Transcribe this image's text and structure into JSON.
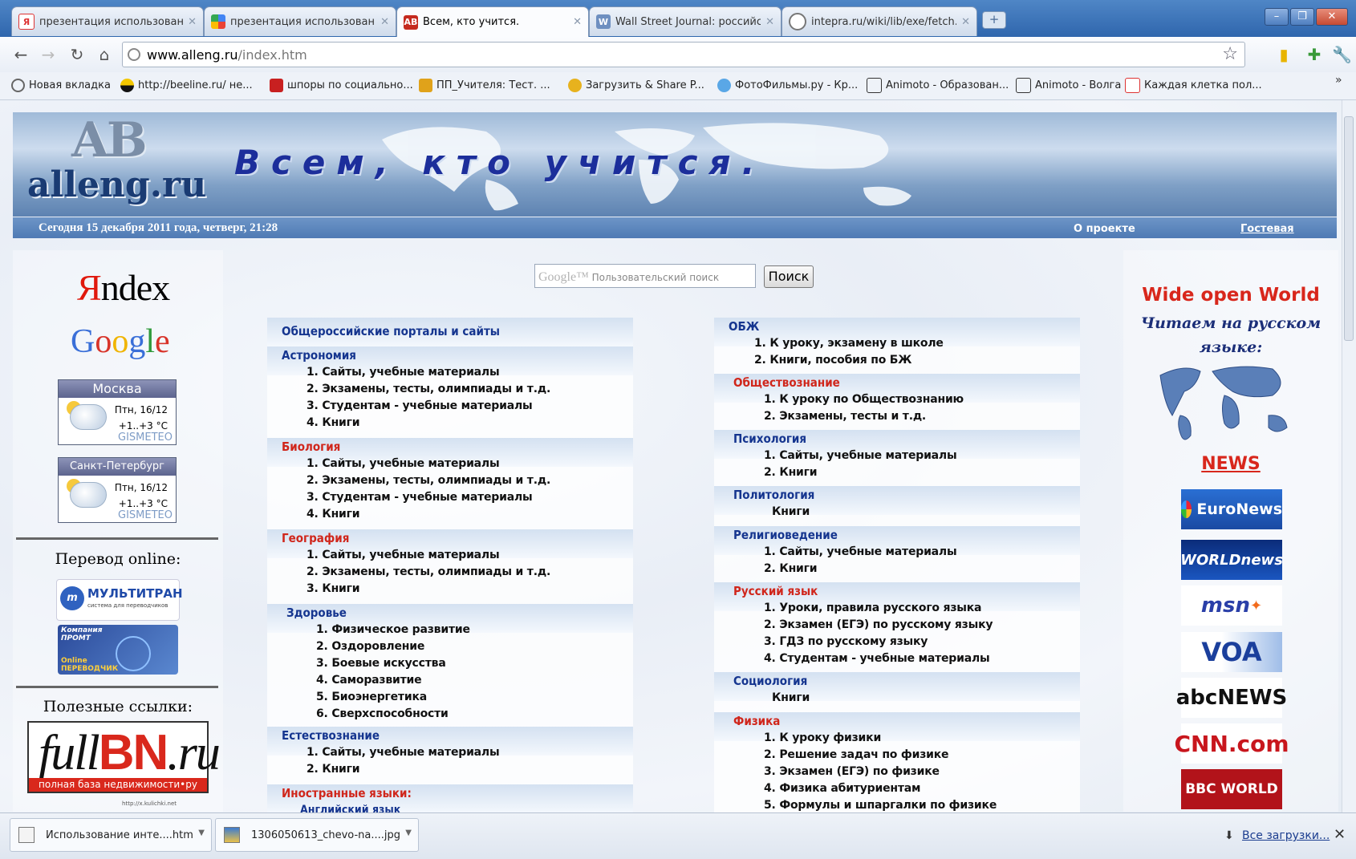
{
  "browser": {
    "tabs": [
      {
        "title": "презентация использование",
        "active": false,
        "icon": "yandex-icon"
      },
      {
        "title": "презентация использование",
        "active": false,
        "icon": "google-icon"
      },
      {
        "title": "Всем, кто учится.",
        "active": true,
        "icon": "alleng-icon"
      },
      {
        "title": "Wall Street Journal: российск",
        "active": false,
        "icon": "wsj-icon"
      },
      {
        "title": "intepra.ru/wiki/lib/exe/fetch.p",
        "active": false,
        "icon": "globe-icon"
      }
    ],
    "url_host": "www.alleng.ru",
    "url_path": "/index.htm",
    "bookmarks": [
      "Новая вкладка",
      "http://beeline.ru/ не...",
      "шпоры по социально...",
      "ПП_Учителя: Тест. ...",
      "Загрузить & Share P...",
      "ФотоФильмы.ру - Кр...",
      "Animoto - Образован...",
      "Animoto - Волга",
      "Каждая клетка пол..."
    ],
    "bookmarks_more": "»"
  },
  "header": {
    "logo_letters": "АВ",
    "logo_site": "alleng.ru",
    "title": "Всем, кто учится.",
    "date": "Сегодня 15 декабря 2011 года, четверг, 21:28",
    "about": "О проекте",
    "guestbook": "Гостевая"
  },
  "left": {
    "yandex_y": "Я",
    "yandex_rest": "ndex",
    "google": "Google",
    "weather": [
      {
        "city": "Москва",
        "date": "Птн, 16/12",
        "temp": "+1..+3 °C",
        "brand": "GISMETEO"
      },
      {
        "city": "Санкт-Петербург",
        "date": "Птн, 16/12",
        "temp": "+1..+3 °C",
        "brand": "GISMETEO"
      }
    ],
    "translate_heading": "Перевод online:",
    "multitran": "МУЛЬТИТРАН",
    "multitran_sub": "система для переводчиков",
    "promt_top": "Компания ПРОМТ",
    "promt_bottom": "Online ПЕРЕВОДЧИК",
    "useful_heading": "Полезные ссылки:",
    "fullbn_a": "full",
    "fullbn_b": "BN",
    "fullbn_c": ".ru",
    "fullbn_sub": "полная база недвижимости•ру",
    "kulichki": "http://x.kulichki.net"
  },
  "search": {
    "placeholder_brand": "Google™",
    "placeholder": "Пользовательский поиск",
    "button": "Поиск"
  },
  "left_categories": [
    {
      "title": "Общероссийские порталы и сайты",
      "color": "blue",
      "items": []
    },
    {
      "title": "Астрономия",
      "color": "blue",
      "items": [
        "1. Сайты, учебные материалы",
        "2. Экзамены, тесты, олимпиады и т.д.",
        "3. Студентам - учебные материалы",
        "4. Книги"
      ]
    },
    {
      "title": "Биология",
      "color": "red",
      "items": [
        "1. Сайты, учебные материалы",
        "2. Экзамены, тесты, олимпиады и т.д.",
        "3. Студентам - учебные материалы",
        "4. Книги"
      ]
    },
    {
      "title": "География",
      "color": "red",
      "items": [
        "1. Сайты, учебные материалы",
        "2. Экзамены, тесты, олимпиады и т.д.",
        "3. Книги"
      ]
    },
    {
      "title": "Здоровье",
      "color": "blue",
      "items": [
        "1. Физическое развитие",
        "2. Оздоровление",
        "3. Боевые искусства",
        "4. Саморазвитие",
        "5. Биоэнергетика",
        "6. Сверхспособности"
      ]
    },
    {
      "title": "Естествознание",
      "color": "blue",
      "items": [
        "1. Сайты, учебные материалы",
        "2. Книги"
      ]
    },
    {
      "title": "Иностранные языки:",
      "color": "red",
      "items": [
        "Английский язык"
      ]
    }
  ],
  "right_categories": [
    {
      "title": "ОБЖ",
      "color": "blue",
      "items": [
        "1. К уроку, экзамену в школе",
        "2. Книги, пособия по БЖ"
      ]
    },
    {
      "title": "Обществознание",
      "color": "red",
      "items": [
        "1. К уроку по Обществознанию",
        "2. Экзамены, тесты и т.д."
      ]
    },
    {
      "title": "Психология",
      "color": "blue",
      "items": [
        "1. Сайты, учебные материалы",
        "2. Книги"
      ]
    },
    {
      "title": "Политология",
      "color": "blue",
      "items": [
        "Книги"
      ]
    },
    {
      "title": "Религиоведение",
      "color": "blue",
      "items": [
        "1. Сайты, учебные материалы",
        "2. Книги"
      ]
    },
    {
      "title": "Русский язык",
      "color": "red",
      "items": [
        "1. Уроки, правила русского языка",
        "2. Экзамен (ЕГЭ) по русскому языку",
        "3. ГДЗ по русскому языку",
        "4. Студентам - учебные материалы"
      ]
    },
    {
      "title": "Социология",
      "color": "blue",
      "items": [
        "Книги"
      ]
    },
    {
      "title": "Физика",
      "color": "red",
      "items": [
        "1. К уроку физики",
        "2. Решение задач по физике",
        "3. Экзамен (ЕГЭ) по физике",
        "4. Физика абитуриентам",
        "5. Формулы и шпаргалки по физике"
      ]
    }
  ],
  "right": {
    "wide_open": "Wide open World",
    "read_ru": "Читаем на русском языке:",
    "news": "NEWS",
    "news_links": [
      "EuroNews",
      "WORLDnews",
      "msn",
      "VOA",
      "abcNEWS",
      "CNN.com",
      "BBC WORLD"
    ]
  },
  "downloads": {
    "items": [
      "Использование инте....htm",
      "1306050613_chevo-na....jpg"
    ],
    "all": "Все загрузки...",
    "close": "✕"
  },
  "colors": {
    "red": "#d0261b",
    "blue": "#15358f",
    "chrome": "#3a6fb5"
  }
}
